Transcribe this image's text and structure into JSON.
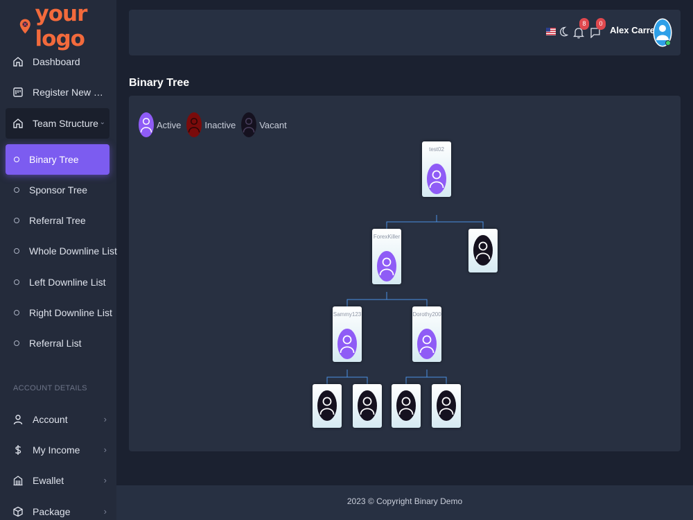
{
  "brand": {
    "logo_text": "your logo",
    "accent": "#f26a3c"
  },
  "sidebar": {
    "items": [
      {
        "label": "Dashboard",
        "icon": "home-icon"
      },
      {
        "label": "Register New Member",
        "icon": "register-icon"
      },
      {
        "label": "Team Structure",
        "icon": "home-icon"
      }
    ],
    "team_structure_sub": [
      "Binary Tree",
      "Sponsor Tree",
      "Referral Tree",
      "Whole Downline List",
      "Left Downline List",
      "Right Downline List",
      "Referral List"
    ],
    "section_label": "ACCOUNT DETAILS",
    "account_items": [
      {
        "label": "Account",
        "icon": "user-icon"
      },
      {
        "label": "My Income",
        "icon": "dollar-icon"
      },
      {
        "label": "Ewallet",
        "icon": "wallet-icon"
      },
      {
        "label": "Package",
        "icon": "package-icon"
      }
    ],
    "active_color": "#7c5cf0"
  },
  "header": {
    "notifications_count": "8",
    "messages_count": "0",
    "username": "Alex Carrey"
  },
  "page": {
    "title": "Binary Tree"
  },
  "legend": {
    "active": "Active",
    "inactive": "Inactive",
    "vacant": "Vacant",
    "active_color": "#8f5cf6",
    "inactive_color": "#7a0b0b",
    "vacant_color": "#15111f"
  },
  "tree": {
    "root": {
      "name": "test02",
      "status": "active"
    },
    "level2": [
      {
        "name": "ForexKiller",
        "status": "active"
      },
      {
        "name": "",
        "status": "vacant"
      }
    ],
    "level3": [
      {
        "name": "Sammy123",
        "status": "active"
      },
      {
        "name": "Dorothy200",
        "status": "active"
      }
    ],
    "level4": [
      {
        "name": "",
        "status": "vacant"
      },
      {
        "name": "",
        "status": "vacant"
      },
      {
        "name": "",
        "status": "vacant"
      },
      {
        "name": "",
        "status": "vacant"
      }
    ],
    "line_color": "#4a90e2"
  },
  "footer": {
    "text": "2023 © Copyright Binary Demo"
  }
}
